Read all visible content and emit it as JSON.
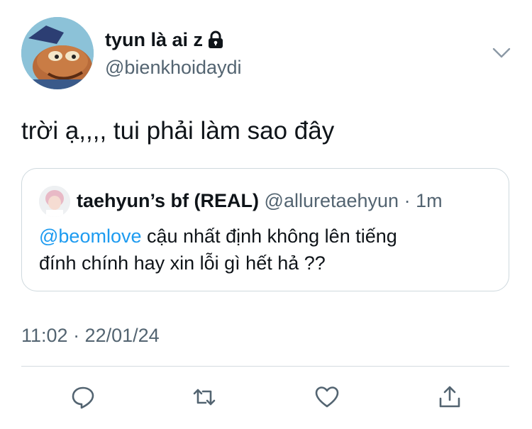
{
  "tweet": {
    "author": {
      "display_name": "tyun là ai z",
      "handle": "@bienkhoidaydi",
      "protected_icon": "lock-icon"
    },
    "text": "trời ạ,,,, tui phải làm sao đây",
    "timestamp": "11:02 · 22/01/24"
  },
  "quote": {
    "display_name": "taehyun’s bf (REAL)",
    "handle": "@alluretaehyun",
    "separator": "·",
    "time": "1m",
    "mention": "@beomlove",
    "text_line_1": " cậu nhất định không lên tiếng",
    "text_line_2": "đính chính hay xin lỗi gì hết hả ??"
  },
  "actions": {
    "reply_icon": "reply-icon",
    "retweet_icon": "retweet-icon",
    "like_icon": "heart-icon",
    "share_icon": "share-icon"
  },
  "colors": {
    "text": "#0f1419",
    "secondary": "#536471",
    "link": "#1d9bf0",
    "border": "#cfd9de"
  }
}
